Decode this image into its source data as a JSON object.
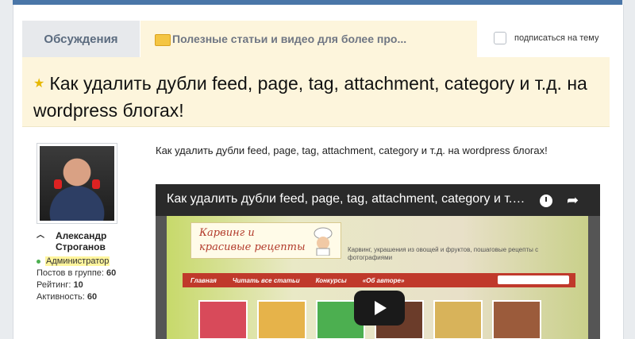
{
  "tabs": {
    "discussions": "Обсуждения",
    "active": "Полезные статьи и видео для более про..."
  },
  "subscribe_label": "подписаться на тему",
  "topic_title": "Как удалить дубли feed, page, tag, attachment, category и т.д. на wordpress блогах!",
  "author": {
    "first_name": "Александр",
    "last_name": "Строганов",
    "role": "Администратор",
    "stats": [
      {
        "label": "Постов в группе:",
        "value": "60"
      },
      {
        "label": "Рейтинг:",
        "value": "10"
      },
      {
        "label": "Активность:",
        "value": "60"
      }
    ]
  },
  "post_text": "Как удалить дубли feed, page, tag, attachment, category и т.д. на wordpress блогах!",
  "video": {
    "title": "Как удалить дубли feed, page, tag, attachment, category и т.д. на wordpress блогах!",
    "site_logo_line1": "Карвинг и",
    "site_logo_line2": "красивые рецепты",
    "site_description": "Карвинг, украшения из овощей и фруктов, пошаговые рецепты с фотографиями",
    "site_nav": [
      "Главная",
      "Читать все статьи",
      "Конкурсы",
      "«Об авторе»"
    ]
  },
  "colors": {
    "accent": "#4a76a8",
    "tab_active_bg": "#fdf5dc",
    "highlight": "#fff59d"
  }
}
